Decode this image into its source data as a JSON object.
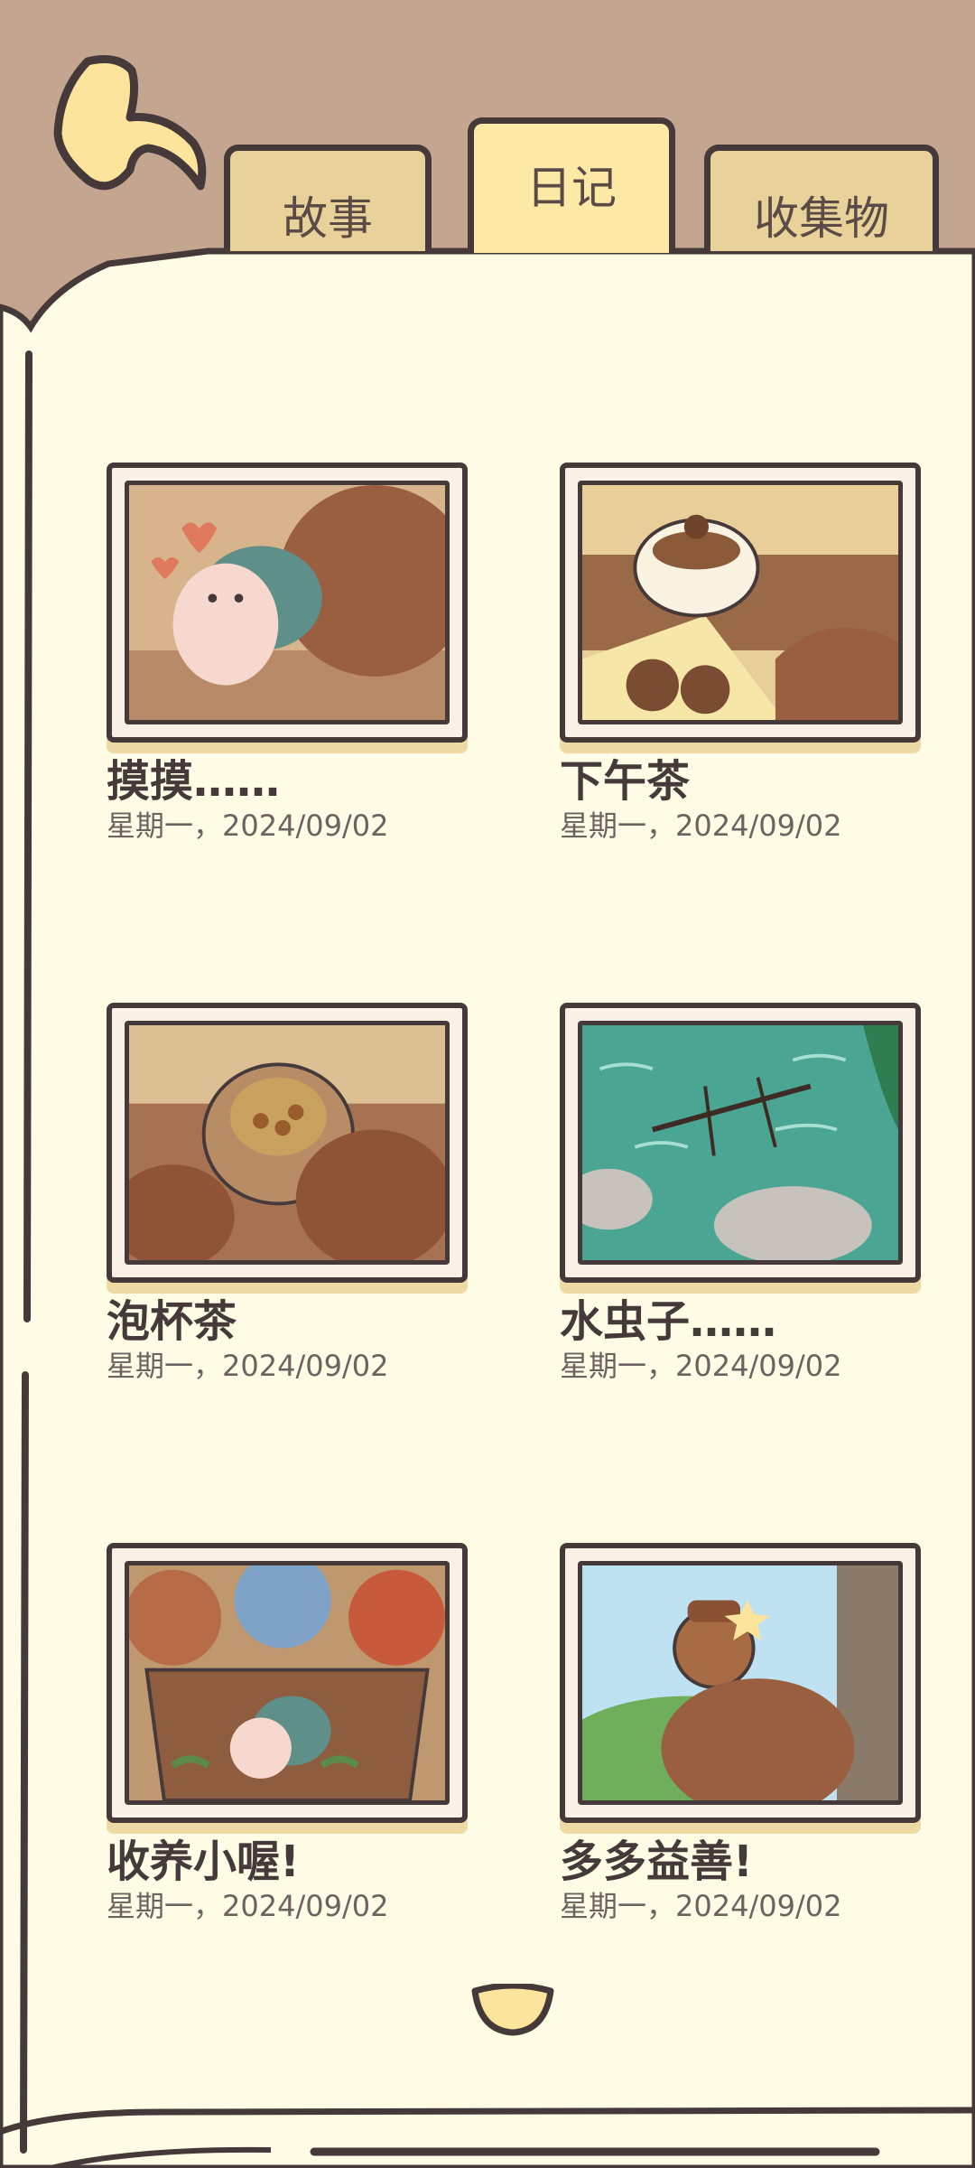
{
  "tabs": [
    {
      "label": "故事",
      "selected": false
    },
    {
      "label": "日记",
      "selected": true
    },
    {
      "label": "收集物",
      "selected": false
    }
  ],
  "entries": [
    {
      "title": "摸摸……",
      "date": "星期一，2024/09/02"
    },
    {
      "title": "下午茶",
      "date": "星期一，2024/09/02"
    },
    {
      "title": "泡杯茶",
      "date": "星期一，2024/09/02"
    },
    {
      "title": "水虫子……",
      "date": "星期一，2024/09/02"
    },
    {
      "title": "收养小喔!",
      "date": "星期一，2024/09/02"
    },
    {
      "title": "多多益善!",
      "date": "星期一，2024/09/02"
    }
  ],
  "icons": {
    "back": "curved-back-arrow-icon",
    "next_page": "chevron-down-icon"
  },
  "colors": {
    "background": "#c4a58f",
    "page": "#fffce6",
    "tab": "#e8d29a",
    "tab_selected": "#fde9a6",
    "outline": "#45393a"
  }
}
